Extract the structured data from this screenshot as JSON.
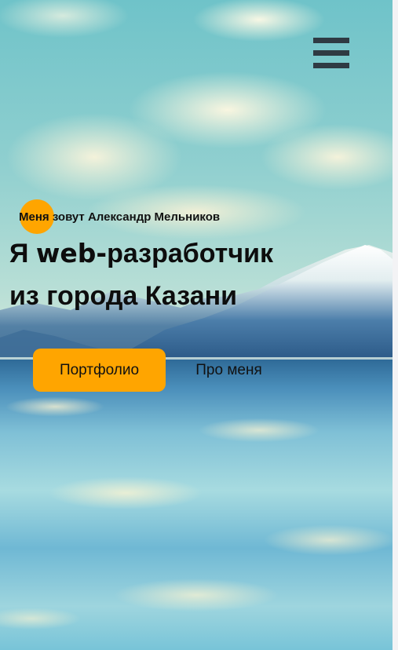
{
  "header": {
    "menu_icon": "hamburger-menu-icon"
  },
  "hero": {
    "intro": "Меня зовут Александр Мельников",
    "headline_prefix": "Я ",
    "headline_web": "web-",
    "headline_rest_line1": "разработчик",
    "headline_line2": "из города Казани",
    "primary_button_label": "Портфолио",
    "secondary_button_label": "Про меня"
  },
  "colors": {
    "accent": "#ffa500",
    "text": "#111111",
    "menu_icon": "#2f3a43",
    "page_background": "#f3f3f5"
  }
}
